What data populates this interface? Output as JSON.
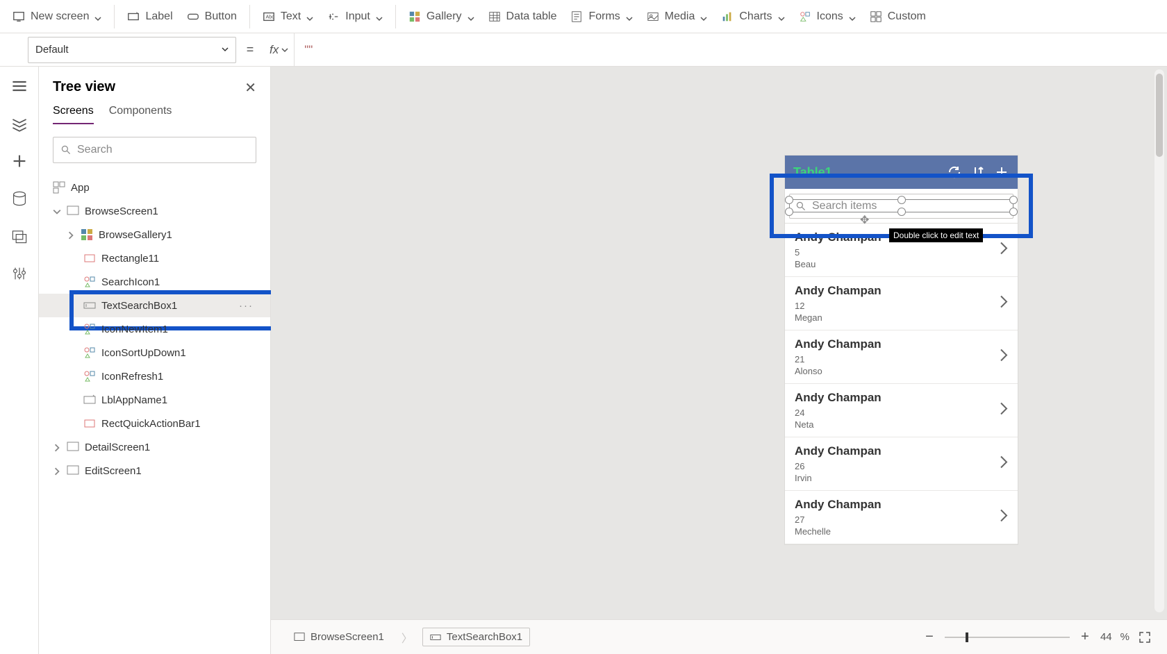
{
  "ribbon": {
    "new_screen": "New screen",
    "label": "Label",
    "button": "Button",
    "text": "Text",
    "input": "Input",
    "gallery": "Gallery",
    "datatable": "Data table",
    "forms": "Forms",
    "media": "Media",
    "charts": "Charts",
    "icons": "Icons",
    "custom": "Custom"
  },
  "property_bar": {
    "property": "Default",
    "fx": "fx",
    "formula_value": "\"\""
  },
  "tree": {
    "title": "Tree view",
    "tab_screens": "Screens",
    "tab_components": "Components",
    "search_placeholder": "Search",
    "items": {
      "app": "App",
      "browse_screen": "BrowseScreen1",
      "browse_gallery": "BrowseGallery1",
      "rectangle": "Rectangle11",
      "search_icon": "SearchIcon1",
      "text_search_box": "TextSearchBox1",
      "icon_new_item": "IconNewItem1",
      "icon_sort": "IconSortUpDown1",
      "icon_refresh": "IconRefresh1",
      "lbl_app_name": "LblAppName1",
      "rect_quick": "RectQuickActionBar1",
      "detail_screen": "DetailScreen1",
      "edit_screen": "EditScreen1"
    }
  },
  "app_preview": {
    "title": "Table1",
    "search_placeholder": "Search items",
    "tooltip": "Double click to edit text",
    "rows": [
      {
        "title": "Andy Champan",
        "num": "5",
        "sub": "Beau"
      },
      {
        "title": "Andy Champan",
        "num": "12",
        "sub": "Megan"
      },
      {
        "title": "Andy Champan",
        "num": "21",
        "sub": "Alonso"
      },
      {
        "title": "Andy Champan",
        "num": "24",
        "sub": "Neta"
      },
      {
        "title": "Andy Champan",
        "num": "26",
        "sub": "Irvin"
      },
      {
        "title": "Andy Champan",
        "num": "27",
        "sub": "Mechelle"
      }
    ]
  },
  "footer": {
    "bc1": "BrowseScreen1",
    "bc2": "TextSearchBox1",
    "zoom": "44",
    "zoom_pct": "%"
  }
}
